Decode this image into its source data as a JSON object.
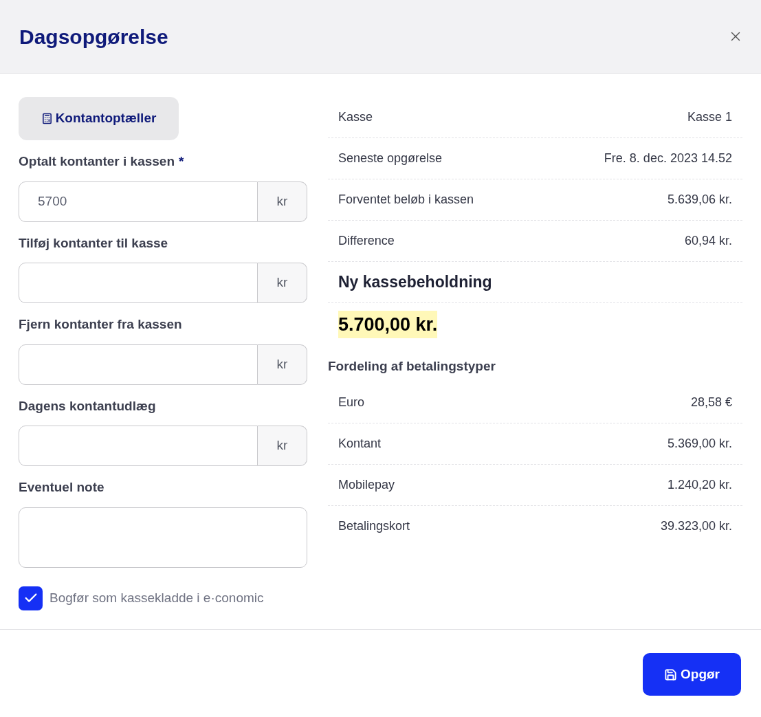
{
  "dialog": {
    "title": "Dagsopgørelse"
  },
  "counter_button": {
    "label": "Kontantoptæller"
  },
  "fields": [
    {
      "kind": "input",
      "label": "Optalt kontanter i kassen",
      "required": true,
      "value": "5700",
      "unit": "kr"
    },
    {
      "kind": "input",
      "label": "Tilføj kontanter til kasse",
      "required": false,
      "unit": "kr"
    },
    {
      "kind": "input",
      "label": "Fjern kontanter fra kassen",
      "required": false,
      "unit": "kr"
    },
    {
      "kind": "input",
      "label": "Dagens kontantudlæg",
      "required": false,
      "unit": "kr"
    },
    {
      "kind": "textarea",
      "label": "Eventuel note",
      "required": false
    }
  ],
  "required_mark": "*",
  "book_checkbox": {
    "label": "Bogfør som kassekladde i e·conomic",
    "checked": true
  },
  "summary": [
    {
      "label": "Kasse",
      "value": "Kasse 1"
    },
    {
      "label": "Seneste opgørelse",
      "value": "Fre. 8. dec. 2023 14.52"
    },
    {
      "label": "Forventet beløb i kassen",
      "value": "5.639,06 kr."
    },
    {
      "label": "Difference",
      "value": "60,94 kr."
    }
  ],
  "new_balance": {
    "label": "Ny kassebeholdning",
    "value": "5.700,00 kr."
  },
  "payment_types": {
    "title": "Fordeling af betalingstyper",
    "rows": [
      {
        "label": "Euro",
        "value": "28,58 €"
      },
      {
        "label": "Kontant",
        "value": "5.369,00 kr."
      },
      {
        "label": "Mobilepay",
        "value": "1.240,20 kr."
      },
      {
        "label": "Betalingskort",
        "value": "39.323,00 kr."
      }
    ]
  },
  "submit_button": {
    "label": "Opgør"
  }
}
